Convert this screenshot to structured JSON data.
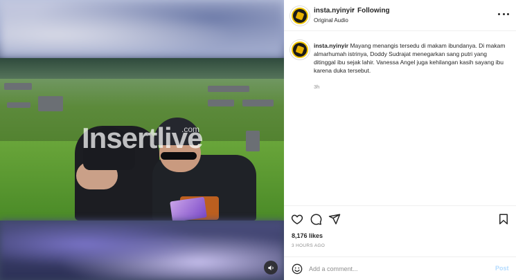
{
  "post": {
    "video": {
      "watermark_main": "Insertlive",
      "watermark_suffix": ".com"
    },
    "header": {
      "username": "insta.nyinyir",
      "separator": "•",
      "follow_status": "Following",
      "audio": "Original Audio"
    },
    "caption": {
      "username": "insta.nyinyir",
      "text": "Mayang menangis tersedu di makam ibundanya. Di makam almarhumah istrinya, Doddy Sudrajat menegarkan sang putri yang ditinggal ibu sejak lahir. Vanessa Angel juga kehilangan kasih sayang ibu karena duka tersebut.",
      "time": "3h"
    },
    "actions": {
      "likes": "8,176 likes",
      "posted_ago": "3 HOURS AGO"
    },
    "comment_box": {
      "placeholder": "Add a comment...",
      "post_label": "Post"
    },
    "icons": {
      "like": "heart-icon",
      "comment": "comment-icon",
      "share": "paper-plane-icon",
      "save": "bookmark-icon",
      "emoji": "smiley-icon",
      "audio": "speaker-icon",
      "more": "more-dots-icon"
    },
    "colors": {
      "post_link_disabled": "#b3dbff",
      "muted_text": "#8e8e8e",
      "border": "#efefef"
    }
  }
}
